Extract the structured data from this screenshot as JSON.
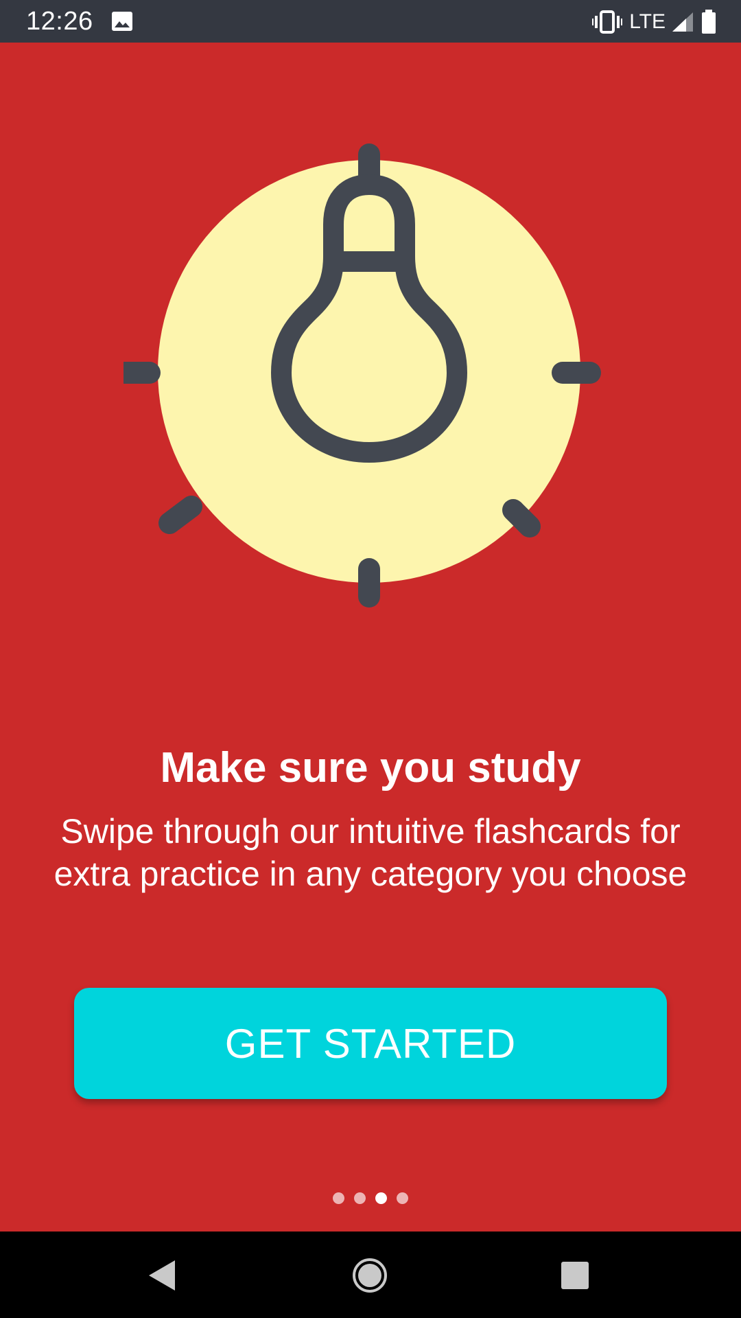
{
  "status_bar": {
    "time": "12:26",
    "network": "LTE",
    "icons": [
      "image-icon",
      "vibrate-icon",
      "signal-icon",
      "battery-icon"
    ]
  },
  "hero": {
    "illustration": "lightbulb-icon",
    "circle_color": "#fdf5ae",
    "line_color": "#434851"
  },
  "onboarding": {
    "title": "Make sure you study",
    "subtitle_line1": "Swipe through our intuitive flashcards for",
    "subtitle_line2": "extra practice in any category you choose",
    "button_label": "GET STARTED",
    "page_index": 3,
    "page_count": 4
  },
  "colors": {
    "background": "#cb2a2a",
    "button": "#00d4dc",
    "status_bar": "#343841",
    "nav_bar": "#000000"
  },
  "nav_bar": {
    "buttons": [
      "back-icon",
      "home-icon",
      "recents-icon"
    ]
  }
}
